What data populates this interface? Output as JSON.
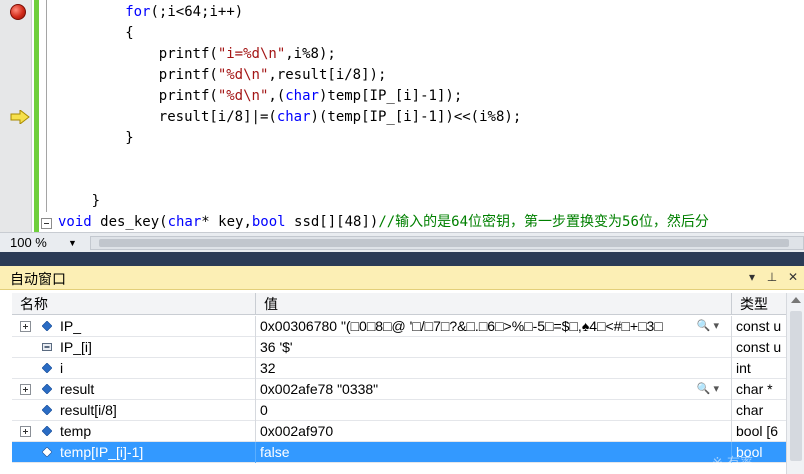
{
  "editor": {
    "lines": [
      {
        "indent": 8,
        "parts": [
          {
            "t": "for",
            "c": "kw"
          },
          {
            "t": "(;i<64;i++)",
            "c": ""
          }
        ]
      },
      {
        "indent": 8,
        "parts": [
          {
            "t": "{",
            "c": ""
          }
        ]
      },
      {
        "indent": 12,
        "parts": [
          {
            "t": "printf(",
            "c": ""
          },
          {
            "t": "\"i=%d\\n\"",
            "c": "str"
          },
          {
            "t": ",i%8);",
            "c": ""
          }
        ]
      },
      {
        "indent": 12,
        "parts": [
          {
            "t": "printf(",
            "c": ""
          },
          {
            "t": "\"%d\\n\"",
            "c": "str"
          },
          {
            "t": ",result[i/8]);",
            "c": ""
          }
        ]
      },
      {
        "indent": 12,
        "parts": [
          {
            "t": "printf(",
            "c": ""
          },
          {
            "t": "\"%d\\n\"",
            "c": "str"
          },
          {
            "t": ",(",
            "c": ""
          },
          {
            "t": "char",
            "c": "kw"
          },
          {
            "t": ")temp[IP_[i]-1]);",
            "c": ""
          }
        ]
      },
      {
        "indent": 12,
        "parts": [
          {
            "t": "result[i/8]|=(",
            "c": ""
          },
          {
            "t": "char",
            "c": "kw"
          },
          {
            "t": ")(temp[IP_[i]-1])<<(i%8);",
            "c": ""
          }
        ]
      },
      {
        "indent": 8,
        "parts": [
          {
            "t": "}",
            "c": ""
          }
        ]
      },
      {
        "indent": 0,
        "parts": [
          {
            "t": "",
            "c": ""
          }
        ]
      },
      {
        "indent": 0,
        "parts": [
          {
            "t": "",
            "c": ""
          }
        ]
      },
      {
        "indent": 4,
        "parts": [
          {
            "t": "}",
            "c": ""
          }
        ]
      },
      {
        "indent": 0,
        "parts": [
          {
            "t": "void",
            "c": "kw"
          },
          {
            "t": " des_key(",
            "c": ""
          },
          {
            "t": "char",
            "c": "kw"
          },
          {
            "t": "* key,",
            "c": ""
          },
          {
            "t": "bool",
            "c": "kw"
          },
          {
            "t": " ssd[][48])",
            "c": ""
          },
          {
            "t": "//输入的是64位密钥，第一步置换变为56位，然后分",
            "c": "cmt"
          }
        ]
      }
    ]
  },
  "zoom": {
    "label": "100 %",
    "arrow": "▼"
  },
  "autos": {
    "title": "自动窗口",
    "title_buttons": [
      "▾",
      "⊥",
      "✕"
    ],
    "columns": [
      "名称",
      "值",
      "类型"
    ],
    "rows": [
      {
        "name": "IP_",
        "value": "0x00306780 \"(□0□8□@ '□/□7□?&□.□6□>%□-5□=$□,♠4□<#□+□3□",
        "type": "const u",
        "expandable": true,
        "icon": "field-icon",
        "magnifier": true,
        "selected": false
      },
      {
        "name": "IP_[i]",
        "value": "36 '$'",
        "type": "const u",
        "expandable": false,
        "icon": "element-icon",
        "magnifier": false,
        "selected": false
      },
      {
        "name": "i",
        "value": "32",
        "type": "int",
        "expandable": false,
        "icon": "field-icon",
        "magnifier": false,
        "selected": false
      },
      {
        "name": "result",
        "value": "0x002afe78 \"0338\"",
        "type": "char *",
        "expandable": true,
        "icon": "field-icon",
        "magnifier": true,
        "selected": false
      },
      {
        "name": "result[i/8]",
        "value": "0",
        "type": "char",
        "expandable": false,
        "icon": "field-icon",
        "magnifier": false,
        "selected": false
      },
      {
        "name": "temp",
        "value": "0x002af970",
        "type": "bool [6",
        "expandable": true,
        "icon": "field-icon",
        "magnifier": false,
        "selected": false
      },
      {
        "name": "temp[IP_[i]-1]",
        "value": "false",
        "type": "bool",
        "expandable": false,
        "icon": "field-icon",
        "magnifier": false,
        "selected": true
      }
    ],
    "magnifier_glyph": "🔍 ▾"
  },
  "watermark": "※ 有率",
  "colors": {
    "selection": "#3399ff",
    "keyword": "#0000ff",
    "string": "#a31515",
    "comment": "#008000",
    "title_bar": "#fcefb5"
  }
}
